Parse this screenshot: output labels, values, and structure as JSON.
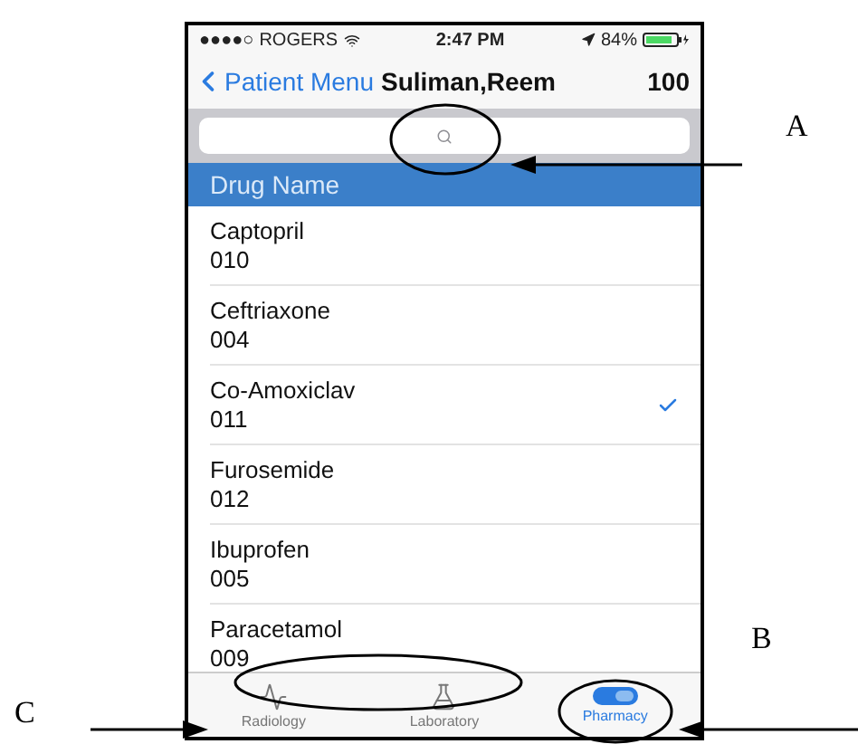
{
  "status_bar": {
    "signal": "●●●●○",
    "carrier": "ROGERS",
    "time": "2:47 PM",
    "battery": "84%"
  },
  "nav": {
    "back": "Patient Menu",
    "title": "Suliman,Reem",
    "number": "100"
  },
  "list_header": "Drug Name",
  "drugs": [
    {
      "name": "Captopril",
      "code": "010",
      "selected": false
    },
    {
      "name": "Ceftriaxone",
      "code": "004",
      "selected": false
    },
    {
      "name": "Co-Amoxiclav",
      "code": "011",
      "selected": true
    },
    {
      "name": "Furosemide",
      "code": "012",
      "selected": false
    },
    {
      "name": "Ibuprofen",
      "code": "005",
      "selected": false
    },
    {
      "name": "Paracetamol",
      "code": "009",
      "selected": false
    }
  ],
  "tabs": [
    {
      "kind": "heartbeat",
      "label": "Radiology",
      "selected": false
    },
    {
      "kind": "flask",
      "label": "Laboratory",
      "selected": false
    },
    {
      "kind": "pill",
      "label": "Pharmacy",
      "selected": true
    }
  ],
  "annotations": [
    {
      "label": "A"
    },
    {
      "label": "B"
    },
    {
      "label": "C"
    }
  ]
}
